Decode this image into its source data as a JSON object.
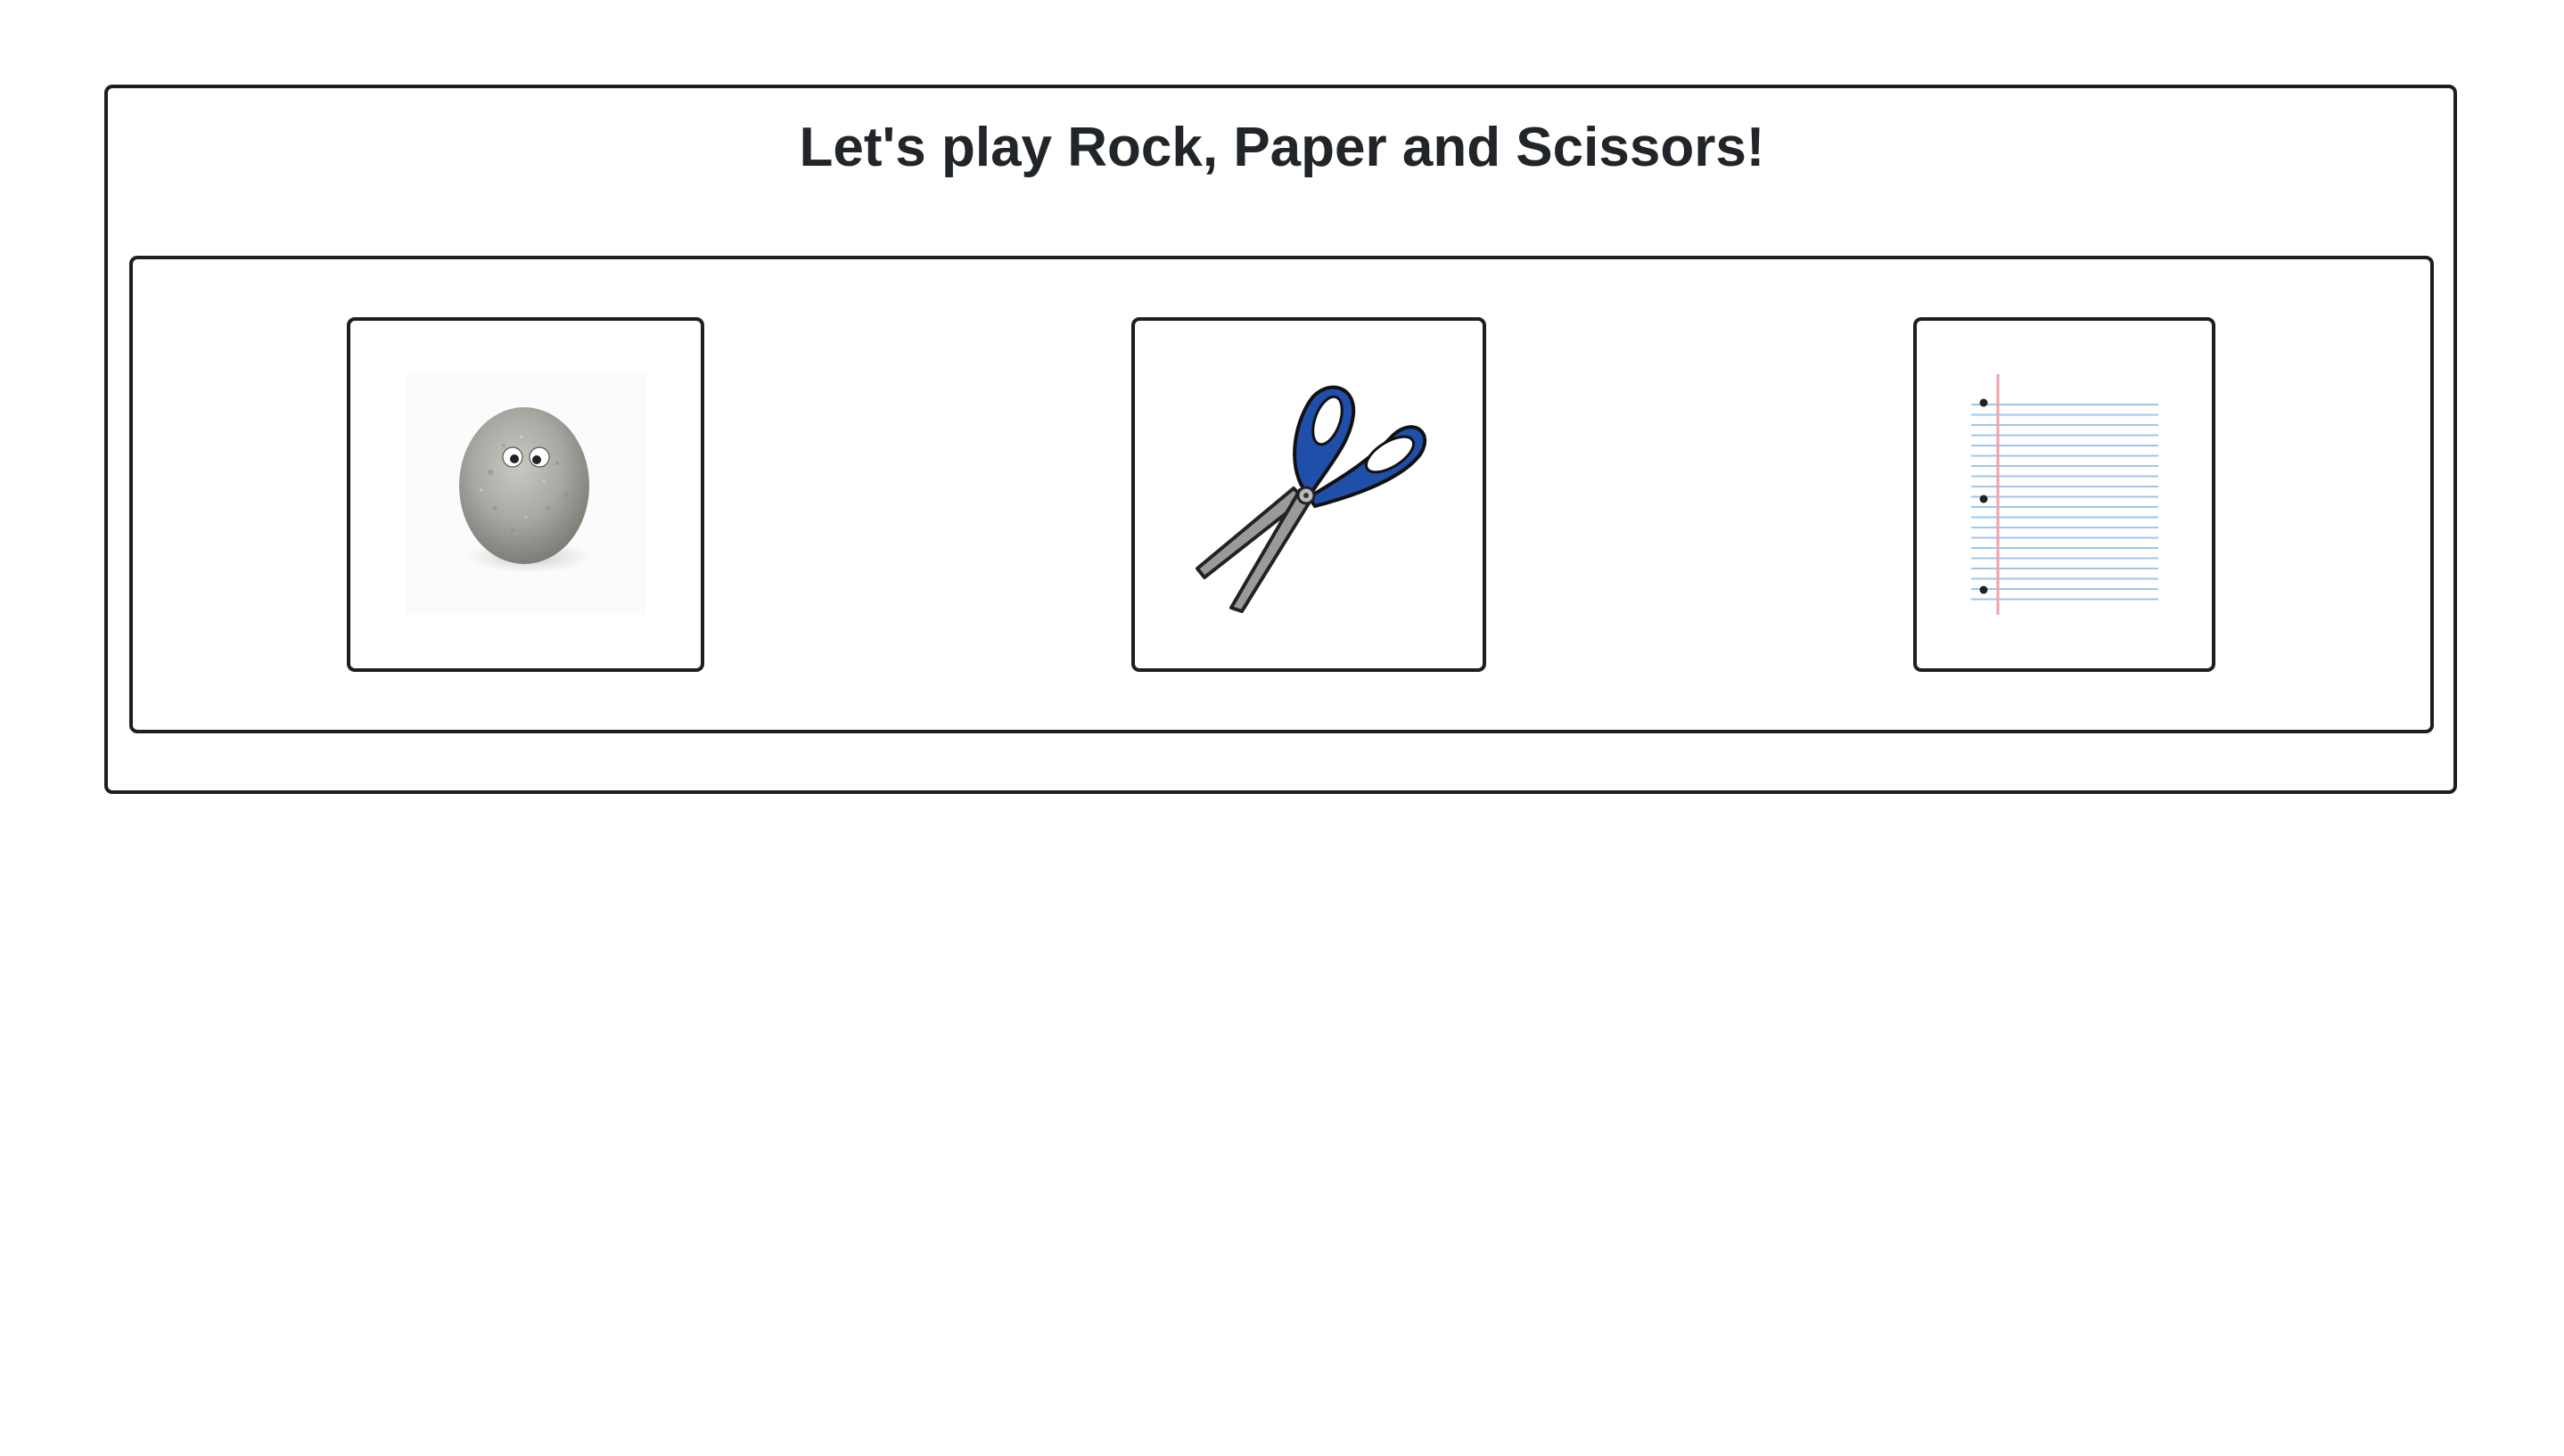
{
  "page": {
    "title": "Let's play Rock, Paper and Scissors!"
  },
  "choices": [
    {
      "id": "rock",
      "icon": "rock-icon"
    },
    {
      "id": "scissors",
      "icon": "scissors-icon"
    },
    {
      "id": "paper",
      "icon": "paper-icon"
    }
  ],
  "colors": {
    "border": "#1e1e1e",
    "title_text": "#212529",
    "scissors_handle": "#1f4fa8",
    "scissors_blade": "#9a9a9a",
    "rock": "#a8a8a4",
    "paper_rule": "#9cc7ee",
    "paper_margin": "#f0a0a8"
  }
}
